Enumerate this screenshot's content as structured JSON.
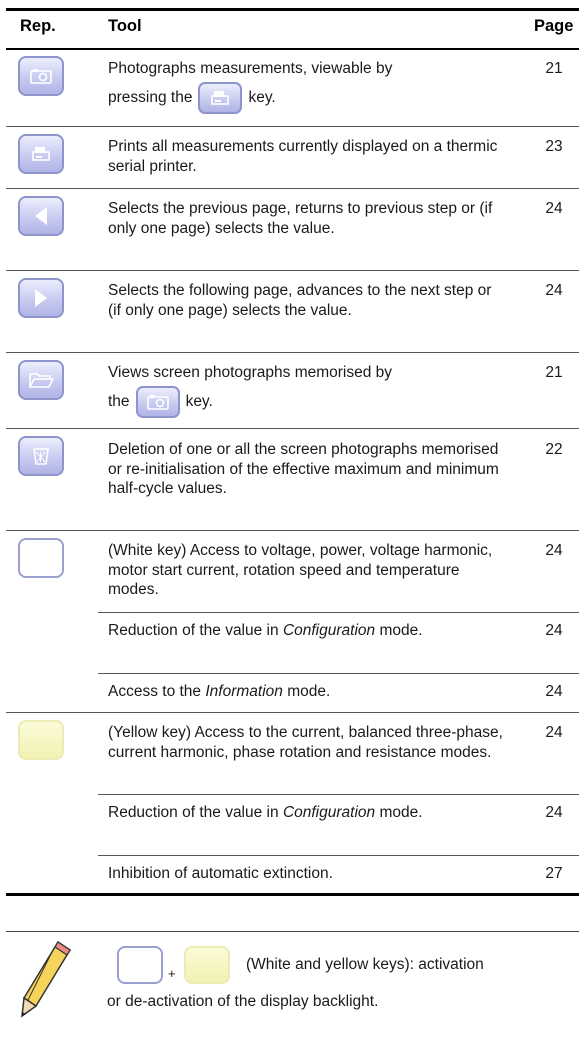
{
  "table": {
    "headers": {
      "rep": "Rep.",
      "tool": "Tool",
      "page": "Page"
    },
    "rows": [
      {
        "icon": "camera-key-icon",
        "line1": "Photographs measurements, viewable by",
        "line2_pre": "pressing the",
        "line2_post": "key.",
        "page": "21"
      },
      {
        "icon": "printer-key-icon",
        "text": "Prints all measurements currently displayed on a thermic serial printer.",
        "page": "23"
      },
      {
        "icon": "left-arrow-key-icon",
        "text": "Selects the previous page, returns to previous step or (if only one page) selects the value.",
        "page": "24"
      },
      {
        "icon": "right-arrow-key-icon",
        "text": "Selects the following page, advances to the next step or (if only one page) selects the value.",
        "page": "24"
      },
      {
        "icon": "folder-key-icon",
        "line1": "Views screen photographs memorised by",
        "line2_pre": "the",
        "line2_post": "key.",
        "page": "21"
      },
      {
        "icon": "trash-key-icon",
        "text": "Deletion of one or all the screen photographs memorised or re-initialisation of the effective maximum and minimum half-cycle values.",
        "page": "22"
      },
      {
        "icon": "white-key-icon",
        "text": "(White key) Access to voltage, power, voltage harmonic, motor start current, rotation speed and temperature modes.",
        "page": "24"
      },
      {
        "text_pre": "Reduction of the value in",
        "text_em": "Configuration",
        "text_post": "mode.",
        "page": "24"
      },
      {
        "text_pre": "Access to the",
        "text_em": "Information",
        "text_post": "mode.",
        "page": "24"
      },
      {
        "icon": "yellow-key-icon",
        "text": "(Yellow key) Access to the current, balanced three-phase, current harmonic, phase rotation and resistance modes.",
        "page": "24"
      },
      {
        "text_pre": "Reduction of the value in",
        "text_em": "Configuration",
        "text_post": "mode.",
        "page": "24"
      },
      {
        "text": "Inhibition of automatic extinction.",
        "page": "27"
      }
    ]
  },
  "note": {
    "plus": "+",
    "line1": "(White and yellow keys): activation",
    "line2": "or de-activation of the display backlight."
  }
}
